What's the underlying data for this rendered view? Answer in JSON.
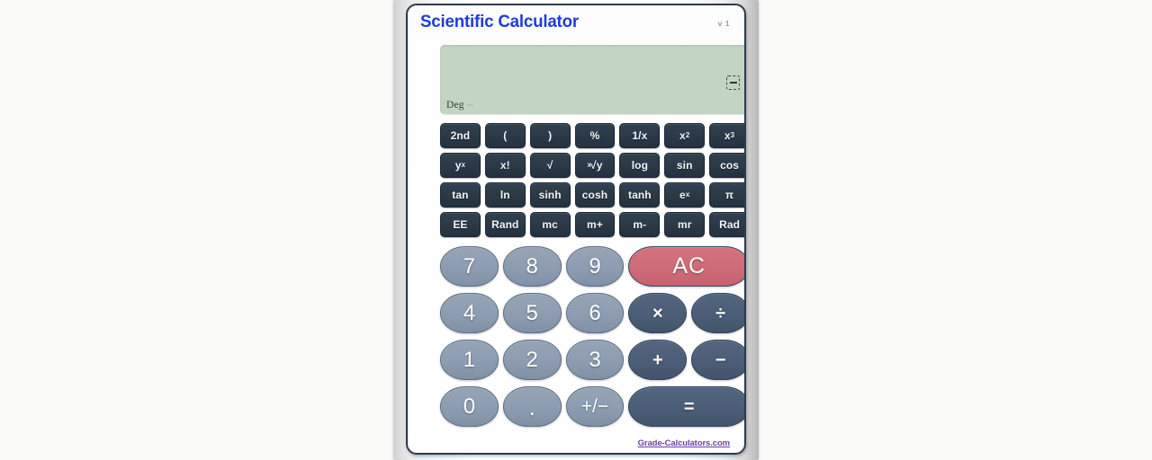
{
  "window": {
    "title": "Scientific Calculator",
    "version": "v 1",
    "title_color": "#1f3bdb",
    "frame_color": "#2b3a4f"
  },
  "display": {
    "value": "",
    "mode_label": "Deg",
    "mode_sub": "···",
    "background_color": "#c4d4c2",
    "backspace_icon": "backspace-icon"
  },
  "function_keys": [
    {
      "label": "2nd",
      "name": "second-function"
    },
    {
      "label": "(",
      "name": "open-paren"
    },
    {
      "label": ")",
      "name": "close-paren"
    },
    {
      "label": "%",
      "name": "percent"
    },
    {
      "label": "1/x",
      "name": "reciprocal"
    },
    {
      "label": "x",
      "sup": "2",
      "name": "square"
    },
    {
      "label": "x",
      "sup": "3",
      "name": "cube"
    },
    {
      "label": "y",
      "sup": "x",
      "name": "power-y-x"
    },
    {
      "label": "x!",
      "name": "factorial"
    },
    {
      "label": "√",
      "name": "square-root"
    },
    {
      "presup": "x",
      "label": "√y",
      "name": "nth-root"
    },
    {
      "label": "log",
      "name": "log"
    },
    {
      "label": "sin",
      "name": "sine"
    },
    {
      "label": "cos",
      "name": "cosine"
    },
    {
      "label": "tan",
      "name": "tangent"
    },
    {
      "label": "ln",
      "name": "natural-log"
    },
    {
      "label": "sinh",
      "name": "hyperbolic-sine"
    },
    {
      "label": "cosh",
      "name": "hyperbolic-cosine"
    },
    {
      "label": "tanh",
      "name": "hyperbolic-tangent"
    },
    {
      "label": "e",
      "sup": "x",
      "name": "exponential"
    },
    {
      "label": "π",
      "name": "pi"
    },
    {
      "label": "EE",
      "name": "exponent-entry"
    },
    {
      "label": "Rand",
      "name": "random"
    },
    {
      "label": "mc",
      "name": "memory-clear"
    },
    {
      "label": "m+",
      "name": "memory-add"
    },
    {
      "label": "m-",
      "name": "memory-subtract"
    },
    {
      "label": "mr",
      "name": "memory-recall"
    },
    {
      "label": "Rad",
      "name": "radian-mode"
    }
  ],
  "pad_keys": [
    {
      "label": "7",
      "name": "digit-7",
      "kind": "num"
    },
    {
      "label": "8",
      "name": "digit-8",
      "kind": "num"
    },
    {
      "label": "9",
      "name": "digit-9",
      "kind": "num"
    },
    {
      "label": "AC",
      "name": "all-clear",
      "kind": "clear"
    },
    {
      "label": "4",
      "name": "digit-4",
      "kind": "num"
    },
    {
      "label": "5",
      "name": "digit-5",
      "kind": "num"
    },
    {
      "label": "6",
      "name": "digit-6",
      "kind": "num"
    },
    {
      "label": "×",
      "name": "multiply",
      "kind": "op"
    },
    {
      "label": "÷",
      "name": "divide",
      "kind": "op"
    },
    {
      "label": "1",
      "name": "digit-1",
      "kind": "num"
    },
    {
      "label": "2",
      "name": "digit-2",
      "kind": "num"
    },
    {
      "label": "3",
      "name": "digit-3",
      "kind": "num"
    },
    {
      "label": "+",
      "name": "add",
      "kind": "op"
    },
    {
      "label": "−",
      "name": "subtract",
      "kind": "op"
    },
    {
      "label": "0",
      "name": "digit-0",
      "kind": "num"
    },
    {
      "label": ".",
      "name": "decimal-point",
      "kind": "num dot"
    },
    {
      "label": "+/−",
      "name": "sign-toggle",
      "kind": "num plusminus"
    },
    {
      "label": "=",
      "name": "equals",
      "kind": "op equals"
    }
  ],
  "footer": {
    "link_text": "Grade-Calculators.com",
    "link_color": "#6b3fa0"
  },
  "colors": {
    "page_background": "#fafaf9",
    "number_key": "#8c9cb0",
    "operator_key": "#4b5d76",
    "clear_key": "#cc6b75",
    "function_key": "#2b3947"
  }
}
